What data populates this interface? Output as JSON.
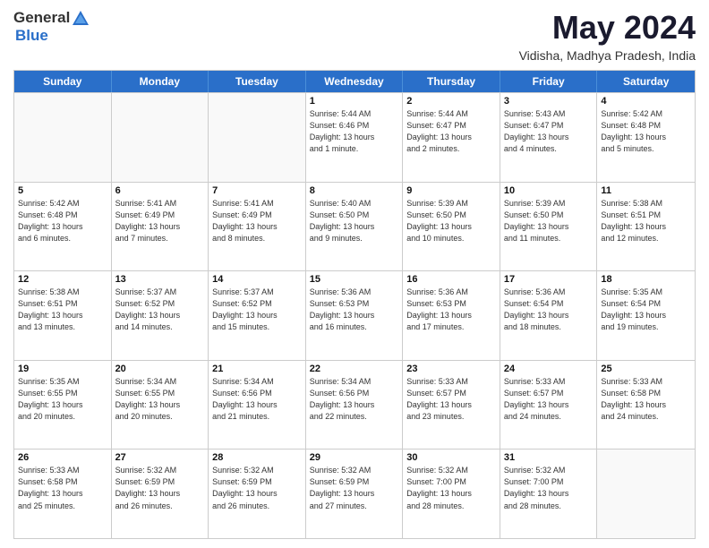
{
  "logo": {
    "general": "General",
    "blue": "Blue"
  },
  "title": "May 2024",
  "subtitle": "Vidisha, Madhya Pradesh, India",
  "days_of_week": [
    "Sunday",
    "Monday",
    "Tuesday",
    "Wednesday",
    "Thursday",
    "Friday",
    "Saturday"
  ],
  "weeks": [
    [
      {
        "day": "",
        "info": "",
        "empty": true
      },
      {
        "day": "",
        "info": "",
        "empty": true
      },
      {
        "day": "",
        "info": "",
        "empty": true
      },
      {
        "day": "1",
        "info": "Sunrise: 5:44 AM\nSunset: 6:46 PM\nDaylight: 13 hours\nand 1 minute.",
        "empty": false
      },
      {
        "day": "2",
        "info": "Sunrise: 5:44 AM\nSunset: 6:47 PM\nDaylight: 13 hours\nand 2 minutes.",
        "empty": false
      },
      {
        "day": "3",
        "info": "Sunrise: 5:43 AM\nSunset: 6:47 PM\nDaylight: 13 hours\nand 4 minutes.",
        "empty": false
      },
      {
        "day": "4",
        "info": "Sunrise: 5:42 AM\nSunset: 6:48 PM\nDaylight: 13 hours\nand 5 minutes.",
        "empty": false
      }
    ],
    [
      {
        "day": "5",
        "info": "Sunrise: 5:42 AM\nSunset: 6:48 PM\nDaylight: 13 hours\nand 6 minutes.",
        "empty": false
      },
      {
        "day": "6",
        "info": "Sunrise: 5:41 AM\nSunset: 6:49 PM\nDaylight: 13 hours\nand 7 minutes.",
        "empty": false
      },
      {
        "day": "7",
        "info": "Sunrise: 5:41 AM\nSunset: 6:49 PM\nDaylight: 13 hours\nand 8 minutes.",
        "empty": false
      },
      {
        "day": "8",
        "info": "Sunrise: 5:40 AM\nSunset: 6:50 PM\nDaylight: 13 hours\nand 9 minutes.",
        "empty": false
      },
      {
        "day": "9",
        "info": "Sunrise: 5:39 AM\nSunset: 6:50 PM\nDaylight: 13 hours\nand 10 minutes.",
        "empty": false
      },
      {
        "day": "10",
        "info": "Sunrise: 5:39 AM\nSunset: 6:50 PM\nDaylight: 13 hours\nand 11 minutes.",
        "empty": false
      },
      {
        "day": "11",
        "info": "Sunrise: 5:38 AM\nSunset: 6:51 PM\nDaylight: 13 hours\nand 12 minutes.",
        "empty": false
      }
    ],
    [
      {
        "day": "12",
        "info": "Sunrise: 5:38 AM\nSunset: 6:51 PM\nDaylight: 13 hours\nand 13 minutes.",
        "empty": false
      },
      {
        "day": "13",
        "info": "Sunrise: 5:37 AM\nSunset: 6:52 PM\nDaylight: 13 hours\nand 14 minutes.",
        "empty": false
      },
      {
        "day": "14",
        "info": "Sunrise: 5:37 AM\nSunset: 6:52 PM\nDaylight: 13 hours\nand 15 minutes.",
        "empty": false
      },
      {
        "day": "15",
        "info": "Sunrise: 5:36 AM\nSunset: 6:53 PM\nDaylight: 13 hours\nand 16 minutes.",
        "empty": false
      },
      {
        "day": "16",
        "info": "Sunrise: 5:36 AM\nSunset: 6:53 PM\nDaylight: 13 hours\nand 17 minutes.",
        "empty": false
      },
      {
        "day": "17",
        "info": "Sunrise: 5:36 AM\nSunset: 6:54 PM\nDaylight: 13 hours\nand 18 minutes.",
        "empty": false
      },
      {
        "day": "18",
        "info": "Sunrise: 5:35 AM\nSunset: 6:54 PM\nDaylight: 13 hours\nand 19 minutes.",
        "empty": false
      }
    ],
    [
      {
        "day": "19",
        "info": "Sunrise: 5:35 AM\nSunset: 6:55 PM\nDaylight: 13 hours\nand 20 minutes.",
        "empty": false
      },
      {
        "day": "20",
        "info": "Sunrise: 5:34 AM\nSunset: 6:55 PM\nDaylight: 13 hours\nand 20 minutes.",
        "empty": false
      },
      {
        "day": "21",
        "info": "Sunrise: 5:34 AM\nSunset: 6:56 PM\nDaylight: 13 hours\nand 21 minutes.",
        "empty": false
      },
      {
        "day": "22",
        "info": "Sunrise: 5:34 AM\nSunset: 6:56 PM\nDaylight: 13 hours\nand 22 minutes.",
        "empty": false
      },
      {
        "day": "23",
        "info": "Sunrise: 5:33 AM\nSunset: 6:57 PM\nDaylight: 13 hours\nand 23 minutes.",
        "empty": false
      },
      {
        "day": "24",
        "info": "Sunrise: 5:33 AM\nSunset: 6:57 PM\nDaylight: 13 hours\nand 24 minutes.",
        "empty": false
      },
      {
        "day": "25",
        "info": "Sunrise: 5:33 AM\nSunset: 6:58 PM\nDaylight: 13 hours\nand 24 minutes.",
        "empty": false
      }
    ],
    [
      {
        "day": "26",
        "info": "Sunrise: 5:33 AM\nSunset: 6:58 PM\nDaylight: 13 hours\nand 25 minutes.",
        "empty": false
      },
      {
        "day": "27",
        "info": "Sunrise: 5:32 AM\nSunset: 6:59 PM\nDaylight: 13 hours\nand 26 minutes.",
        "empty": false
      },
      {
        "day": "28",
        "info": "Sunrise: 5:32 AM\nSunset: 6:59 PM\nDaylight: 13 hours\nand 26 minutes.",
        "empty": false
      },
      {
        "day": "29",
        "info": "Sunrise: 5:32 AM\nSunset: 6:59 PM\nDaylight: 13 hours\nand 27 minutes.",
        "empty": false
      },
      {
        "day": "30",
        "info": "Sunrise: 5:32 AM\nSunset: 7:00 PM\nDaylight: 13 hours\nand 28 minutes.",
        "empty": false
      },
      {
        "day": "31",
        "info": "Sunrise: 5:32 AM\nSunset: 7:00 PM\nDaylight: 13 hours\nand 28 minutes.",
        "empty": false
      },
      {
        "day": "",
        "info": "",
        "empty": true
      }
    ]
  ]
}
